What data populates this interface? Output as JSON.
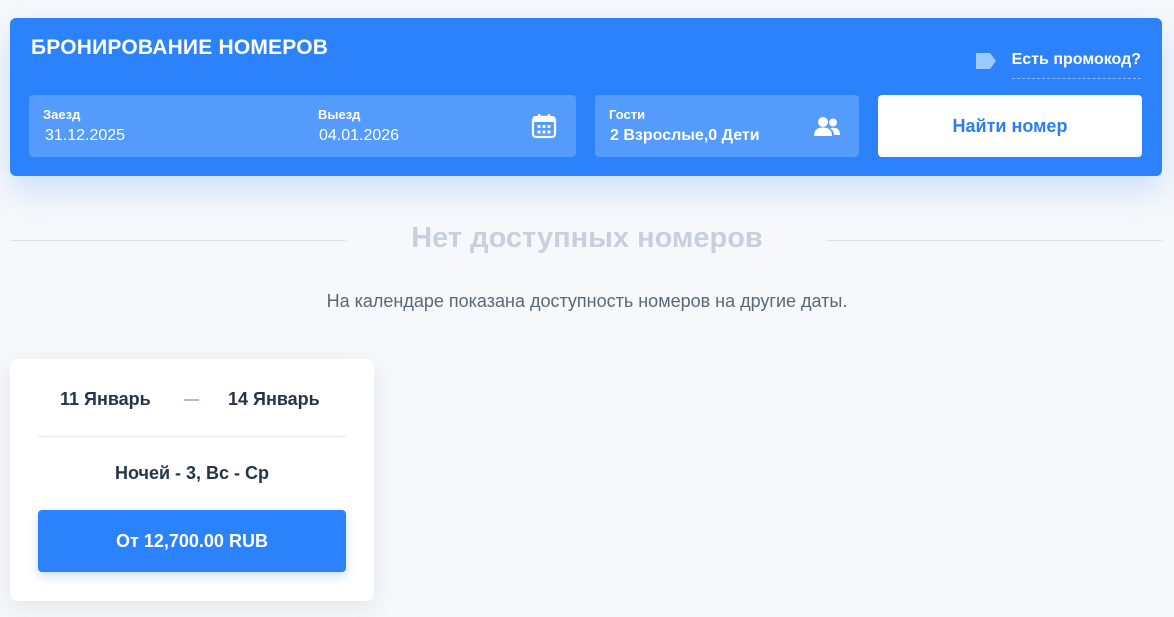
{
  "booking": {
    "title": "БРОНИРОВАНИЕ НОМЕРОВ",
    "promo_label": "Есть промокод?",
    "checkin_label": "Заезд",
    "checkin_value": "31.12.2025",
    "checkout_label": "Выезд",
    "checkout_value": "04.01.2026",
    "guests_label": "Гости",
    "guests_value": "2 Взрослые,0 Дети",
    "search_button": "Найти номер",
    "icons": {
      "promo": "tag-icon",
      "dates": "calendar-icon",
      "guests": "users-icon"
    }
  },
  "results": {
    "heading": "Нет доступных номеров",
    "info": "На календаре показана доступность номеров на другие даты."
  },
  "alternative": {
    "from": "11 Январь",
    "to": "14 Январь",
    "nights": "Ночей - 3, Вс - Ср",
    "price_button": "От 12,700.00 RUB"
  },
  "colors": {
    "accent": "#2b82fb",
    "heading_muted": "#c8d0dc",
    "text_dark": "#25344a"
  }
}
